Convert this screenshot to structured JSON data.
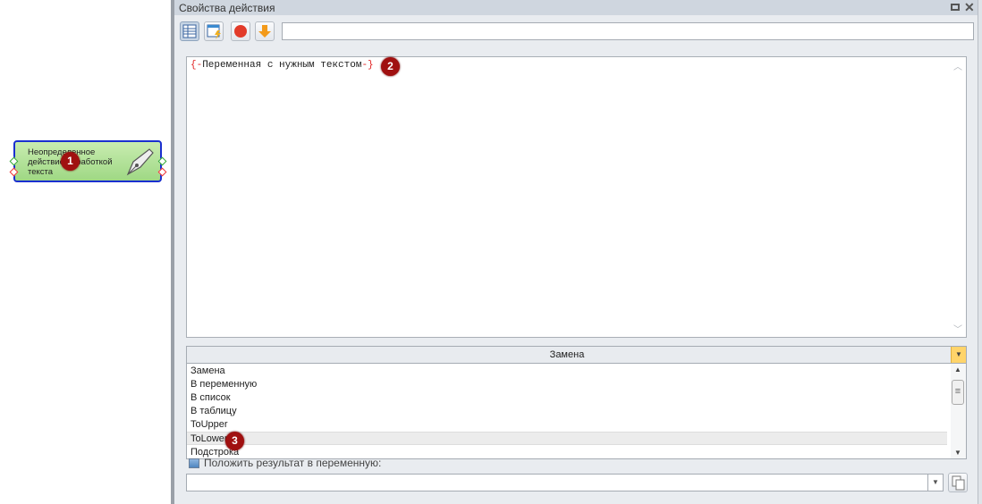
{
  "node": {
    "label": "Неопределенное действие обработкой текста",
    "badge": "1",
    "icon": "pen-nib-icon"
  },
  "panel": {
    "title": "Свойства действия",
    "maximize_icon": "maximize-icon",
    "close_icon": "close-icon"
  },
  "toolbar": {
    "buttons": [
      "table-view-icon",
      "window-lightning-icon",
      "stop-icon",
      "arrow-down-icon"
    ],
    "input_value": ""
  },
  "editor": {
    "open": "{-",
    "variable": "Переменная с нужным текстом",
    "close": "-}",
    "badge": "2"
  },
  "combo": {
    "selected": "Замена",
    "options": [
      "Замена",
      "В переменную",
      "В список",
      "В таблицу",
      "ToUpper",
      "ToLower",
      "Подстрока"
    ],
    "hover_index": 5,
    "badge": "3"
  },
  "result": {
    "checkbox_label": "Положить результат в переменную:",
    "value": ""
  },
  "colors": {
    "badge": "#a01010",
    "node_border": "#1a2fd0",
    "accent": "#ffd46a"
  }
}
